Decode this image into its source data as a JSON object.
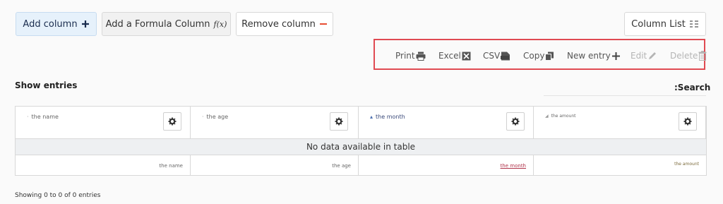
{
  "buttons": {
    "add_column": "Add column",
    "add_formula": "Add a Formula Column",
    "formula_icon_text": "f(x)",
    "remove_column": "Remove column",
    "column_list": "Column List"
  },
  "toolbar": {
    "print": "Print",
    "excel": "Excel",
    "csv": "CSV",
    "copy": "Copy",
    "new_entry": "New entry",
    "edit": "Edit",
    "delete": "Delete"
  },
  "show_entries": "Show entries",
  "search_label": ":Search",
  "table": {
    "headers": [
      "the name",
      "the age",
      "the month",
      "the amount"
    ],
    "empty_message": "No data available in table",
    "footers": [
      "the name",
      "the age",
      "the month",
      "the amount"
    ]
  },
  "info": "Showing 0 to 0 of 0 entries",
  "colors": {
    "accent": "#1a2c4e",
    "highlight_border": "#e04a52",
    "remove_icon": "#e8553a",
    "empty_row_bg": "#eef0f2"
  }
}
